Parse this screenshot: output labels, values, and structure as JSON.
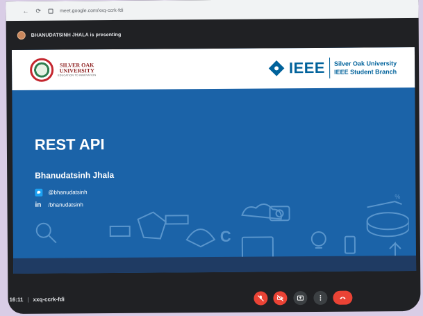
{
  "browser": {
    "url": "meet.google.com/xxq-ccrk-fdi"
  },
  "presenting": {
    "text": "BHANUDATSINH JHALA is presenting"
  },
  "slide": {
    "header": {
      "left_logo_line1": "SILVER OAK",
      "left_logo_line2": "UNIVERSITY",
      "left_logo_tagline": "EDUCATION TO INNOVATION",
      "right_logo_word": "IEEE",
      "right_logo_line1": "Silver Oak University",
      "right_logo_line2": "IEEE Student Branch"
    },
    "title": "REST API",
    "author": "Bhanudatsinh Jhala",
    "twitter_handle": "@bhanudatsinh",
    "linkedin_icon": "in",
    "linkedin_handle": "/bhanudatsinh"
  },
  "meeting": {
    "time": "16:11",
    "separator": "|",
    "code": "xxq-ccrk-fdi"
  },
  "controls": [
    {
      "name": "mic-off-icon",
      "state": "off"
    },
    {
      "name": "camera-off-icon",
      "state": "off"
    },
    {
      "name": "present-icon",
      "state": "on"
    },
    {
      "name": "more-options-icon",
      "state": "on"
    },
    {
      "name": "end-call-icon",
      "state": "end"
    }
  ],
  "colors": {
    "slide_blue": "#1b63a8",
    "meet_dark": "#202124",
    "danger_red": "#ea4335",
    "ieee_blue": "#00629b"
  }
}
